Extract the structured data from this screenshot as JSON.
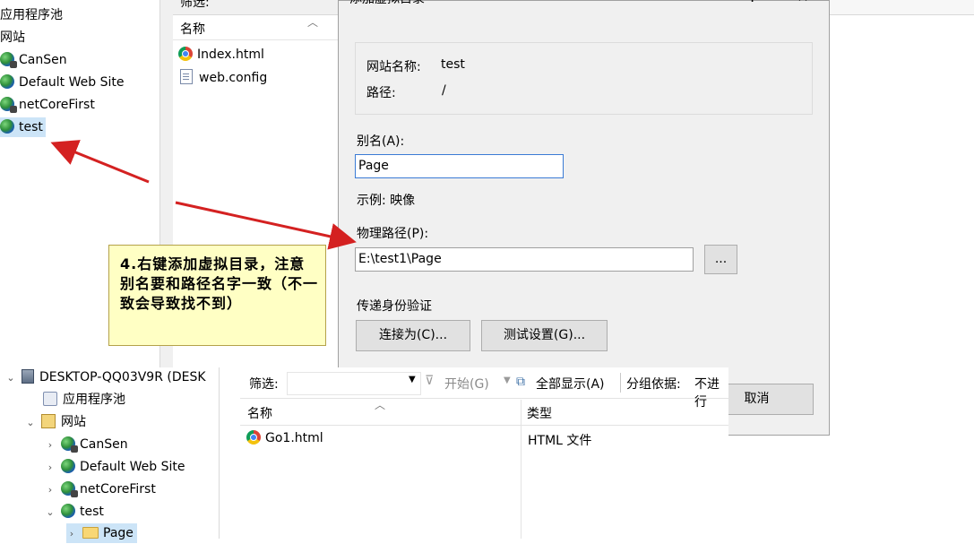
{
  "top_tree": {
    "app_pools": "应用程序池",
    "sites": "网站",
    "items": [
      "CanSen",
      "Default Web Site",
      "netCoreFirst",
      "test"
    ]
  },
  "top_files": {
    "filter_label": "筛选:",
    "col_name": "名称",
    "files": [
      "Index.html",
      "web.config"
    ]
  },
  "dialog": {
    "title": "添加虚拟目录",
    "minimize": "?",
    "close": "✕",
    "site_name_label": "网站名称:",
    "site_name_value": "test",
    "path_label": "路径:",
    "path_value": "/",
    "alias_label": "别名(A):",
    "alias_value": "Page",
    "example": "示例: 映像",
    "physical_path_label": "物理路径(P):",
    "physical_path_value": "E:\\test1\\Page",
    "browse_label": "...",
    "auth_label": "传递身份验证",
    "connect_as_label": "连接为(C)...",
    "test_settings_label": "测试设置(G)...",
    "cancel_label": "取消"
  },
  "callout": {
    "text": "4.右键添加虚拟目录，注意别名要和路径名字一致（不一致会导致找不到）"
  },
  "lower_tree": {
    "server": "DESKTOP-QQ03V9R (DESK",
    "app_pools": "应用程序池",
    "sites": "网站",
    "items": [
      "CanSen",
      "Default Web Site",
      "netCoreFirst",
      "test"
    ],
    "child": "Page"
  },
  "lower_main": {
    "filter_label": "筛选:",
    "start_label": "开始(G)",
    "show_all_label": "全部显示(A)",
    "group_by_label": "分组依据:",
    "group_by_value": "不进行",
    "col_name": "名称",
    "col_type": "类型",
    "file_name": "Go1.html",
    "file_type": "HTML 文件"
  },
  "colors": {
    "arrow": "#d42121",
    "callout_bg": "#ffffc4",
    "selection": "#cce4f7"
  }
}
